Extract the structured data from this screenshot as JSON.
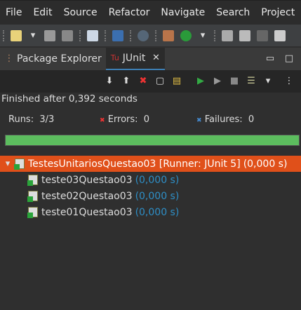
{
  "menu": [
    "File",
    "Edit",
    "Source",
    "Refactor",
    "Navigate",
    "Search",
    "Project"
  ],
  "tabs": {
    "package_explorer": "Package Explorer",
    "junit": "JUnit"
  },
  "status": "Finished after 0,392 seconds",
  "counts": {
    "runs_label": "Runs:",
    "runs": "3/3",
    "errors_label": "Errors:",
    "errors": "0",
    "failures_label": "Failures:",
    "failures": "0"
  },
  "progress": 1.0,
  "colors": {
    "progress": "#5cbd5e",
    "selection": "#e0501a",
    "duration": "#2e8fc7"
  },
  "tree": {
    "root": {
      "name": "TestesUnitariosQuestao03 [Runner: JUnit 5]",
      "duration": "(0,000 s)"
    },
    "children": [
      {
        "name": "teste03Questao03",
        "duration": "(0,000 s)"
      },
      {
        "name": "teste02Questao03",
        "duration": "(0,000 s)"
      },
      {
        "name": "teste01Questao03",
        "duration": "(0,000 s)"
      }
    ]
  }
}
